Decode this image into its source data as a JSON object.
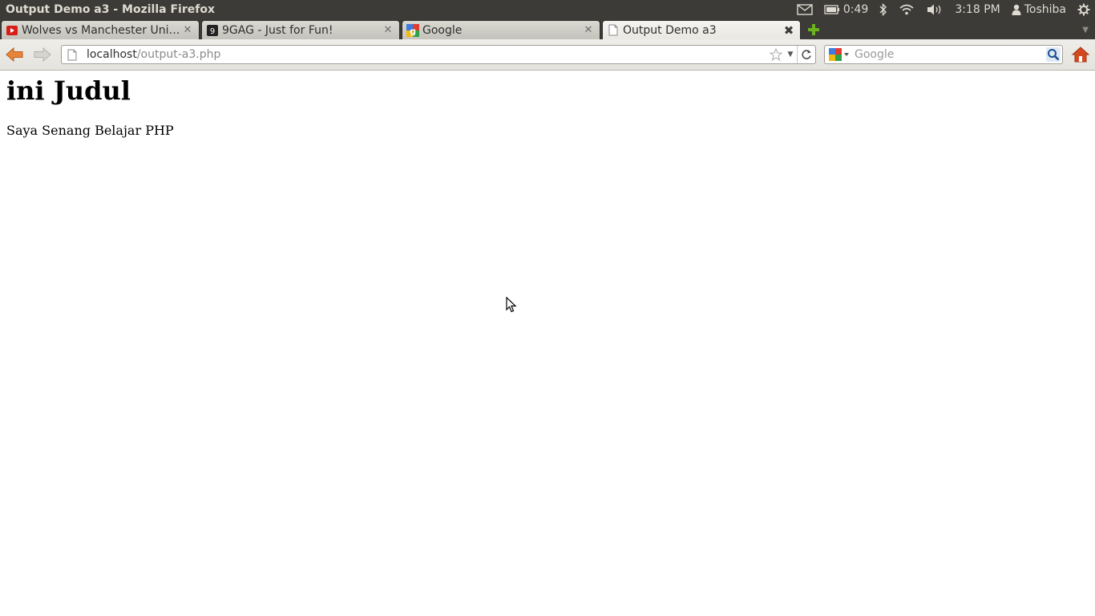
{
  "window": {
    "title": "Output Demo a3 - Mozilla Firefox"
  },
  "indicators": {
    "battery_time": "0:49",
    "clock": "3:18 PM",
    "user": "Toshiba"
  },
  "tabs": [
    {
      "title": "Wolves vs Manchester Unit…",
      "icon": "youtube-icon",
      "active": false
    },
    {
      "title": "9GAG - Just for Fun!",
      "icon": "9gag-icon",
      "active": false
    },
    {
      "title": "Google",
      "icon": "google-icon",
      "active": false
    },
    {
      "title": "Output Demo a3",
      "icon": "page-icon",
      "active": true
    }
  ],
  "url": {
    "host": "localhost",
    "path": "/output-a3.php"
  },
  "search": {
    "placeholder": "Google",
    "value": ""
  },
  "page": {
    "heading": "ini Judul",
    "paragraph": "Saya Senang Belajar PHP"
  },
  "colors": {
    "topbar": "#3c3b37",
    "back_arrow": "#e8843a",
    "newtab_plus": "#6ab31c",
    "home": "#d44a1f"
  }
}
